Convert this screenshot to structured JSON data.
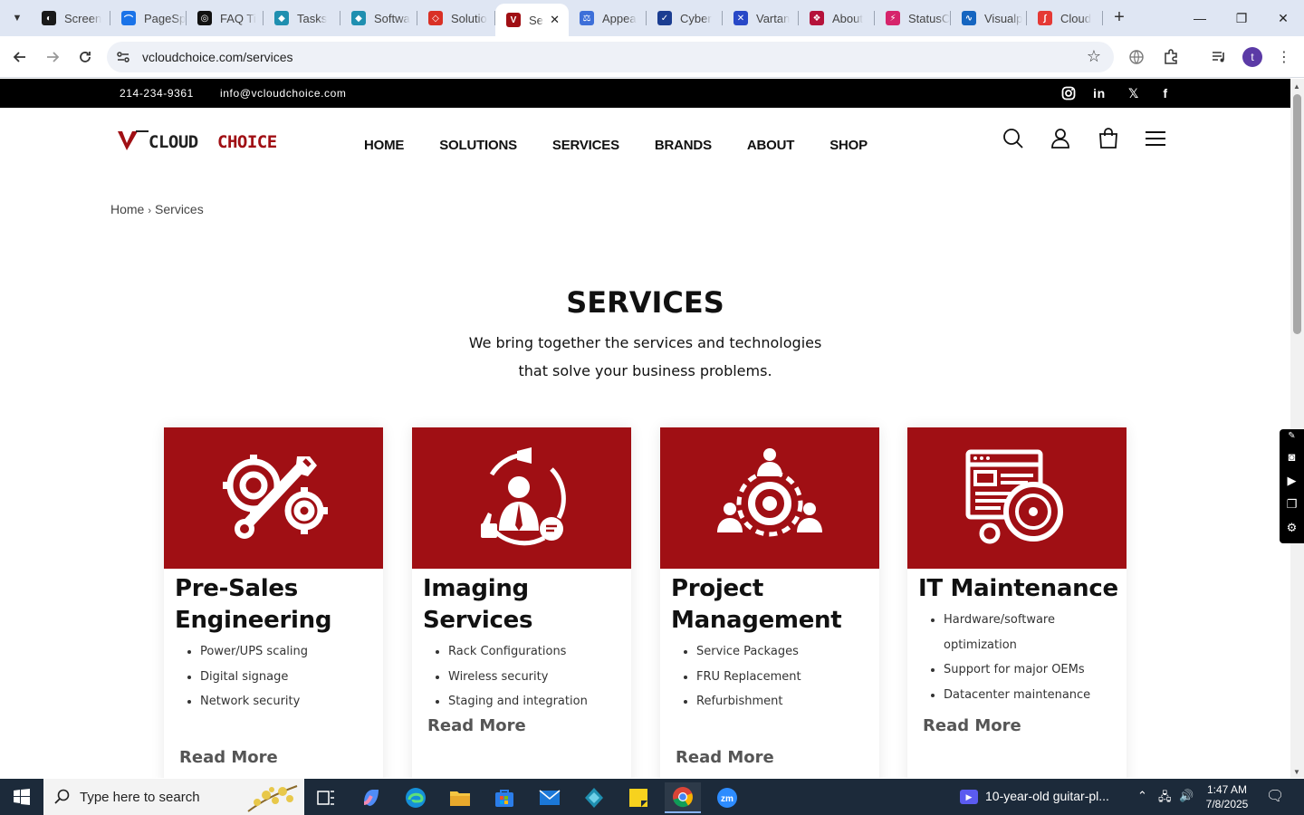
{
  "browser": {
    "tabs": [
      {
        "label": "Screen",
        "color": "#1a1a1a",
        "glyph": "◐"
      },
      {
        "label": "PageSp",
        "color": "#1a73e8",
        "glyph": "⌒"
      },
      {
        "label": "FAQ Ti",
        "color": "#111111",
        "glyph": "◎"
      },
      {
        "label": "Tasks",
        "color": "#1f8fb0",
        "glyph": "◆"
      },
      {
        "label": "Softwa",
        "color": "#1f8fb0",
        "glyph": "◆"
      },
      {
        "label": "Solutio",
        "color": "#d93025",
        "glyph": "◇"
      },
      {
        "label": "Se",
        "color": "#a00f14",
        "glyph": "V",
        "active": true
      },
      {
        "label": "Appea",
        "color": "#3d6fd9",
        "glyph": "⚖"
      },
      {
        "label": "Cyber",
        "color": "#1b3d91",
        "glyph": "✓"
      },
      {
        "label": "Vartan",
        "color": "#2848c7",
        "glyph": "✕"
      },
      {
        "label": "About",
        "color": "#b5123a",
        "glyph": "❖"
      },
      {
        "label": "StatusC",
        "color": "#d6246b",
        "glyph": "⚡"
      },
      {
        "label": "Visualp",
        "color": "#1565c0",
        "glyph": "∿"
      },
      {
        "label": "Cloud",
        "color": "#e53935",
        "glyph": "∫"
      }
    ],
    "url": "vcloudchoice.com/services",
    "profile_initial": "t"
  },
  "site": {
    "phone": "214-234-9361",
    "email": "info@vcloudchoice.com",
    "social": [
      "instagram",
      "linkedin",
      "x",
      "facebook"
    ],
    "logo": {
      "v": "V",
      "text_dark": "CLOUD",
      "text_red": "CHOICE"
    },
    "nav": [
      "HOME",
      "SOLUTIONS",
      "SERVICES",
      "BRANDS",
      "ABOUT",
      "SHOP"
    ],
    "breadcrumb": {
      "home": "Home",
      "current": "Services"
    },
    "title": "SERVICES",
    "subtitle_line1": "We bring together the services and technologies",
    "subtitle_line2": "that solve your business problems.",
    "brand_red": "#a00f14",
    "read_more": "Read More"
  },
  "cards": [
    {
      "title": "Pre-Sales Engineering",
      "icon": "gears-wrench-icon",
      "items": [
        "Power/UPS scaling",
        "Digital signage",
        "Network security"
      ]
    },
    {
      "title": "Imaging Services",
      "icon": "presenter-cycle-icon",
      "items": [
        "Rack Configurations",
        "Wireless security",
        "Staging and integration"
      ]
    },
    {
      "title": "Project Management",
      "icon": "team-gear-icon",
      "items": [
        "Service Packages",
        "FRU Replacement",
        "Refurbishment"
      ]
    },
    {
      "title": "IT Maintenance",
      "icon": "browser-gear-icon",
      "items": [
        "Hardware/software optimization",
        "Support for major OEMs",
        "Datacenter maintenance"
      ]
    }
  ],
  "taskbar": {
    "search_placeholder": "Type here to search",
    "media_title": "10-year-old guitar-pl...",
    "time": "1:47 AM",
    "date": "7/8/2025"
  }
}
